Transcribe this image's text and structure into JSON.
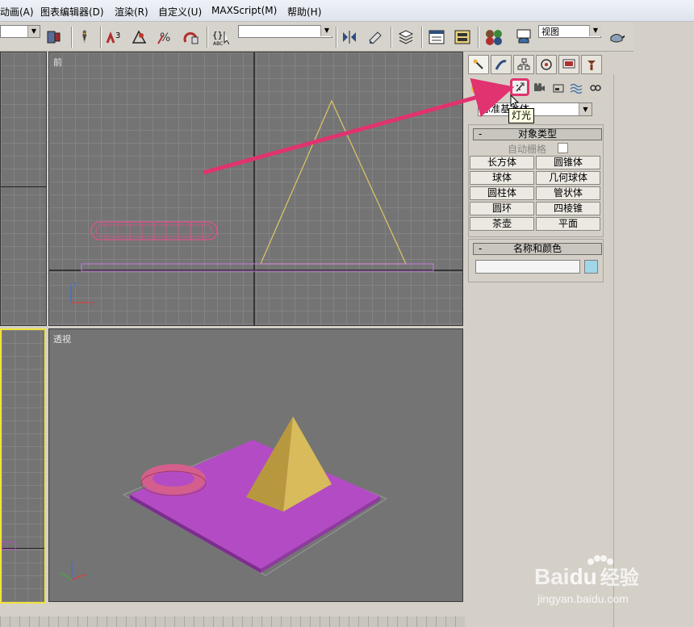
{
  "menu": [
    "动画(A)",
    "图表编辑器(D)",
    "渲染(R)",
    "自定义(U)",
    "MAXScript(M)",
    "帮助(H)"
  ],
  "toolbar": {
    "view_combo_value": "视图",
    "selection_combo_value": "",
    "snap_label": "3"
  },
  "viewports": {
    "front": "前",
    "perspective": "透视"
  },
  "panel": {
    "dropdown_value": "标准基本体",
    "tooltip": "灯光",
    "rollout_object_type": {
      "title": "对象类型",
      "autogrid_label": "自动栅格",
      "buttons": [
        "长方体",
        "圆锥体",
        "球体",
        "几何球体",
        "圆柱体",
        "管状体",
        "圆环",
        "四棱锥",
        "茶壶",
        "平面"
      ]
    },
    "rollout_name_color": {
      "title": "名称和颜色",
      "name_value": ""
    }
  },
  "watermark": {
    "brand": "Bai",
    "brand2": "du",
    "suffix": "经验",
    "url": "jingyan.baidu.com"
  },
  "colors": {
    "highlight_pink": "#e0336f",
    "arrow": "#e0336f",
    "viewport_bg": "#747474",
    "active_border": "#f2e23a",
    "torus": "#d45f8c",
    "plane": "#b34cc4",
    "pyramid": "#c8a94a"
  }
}
